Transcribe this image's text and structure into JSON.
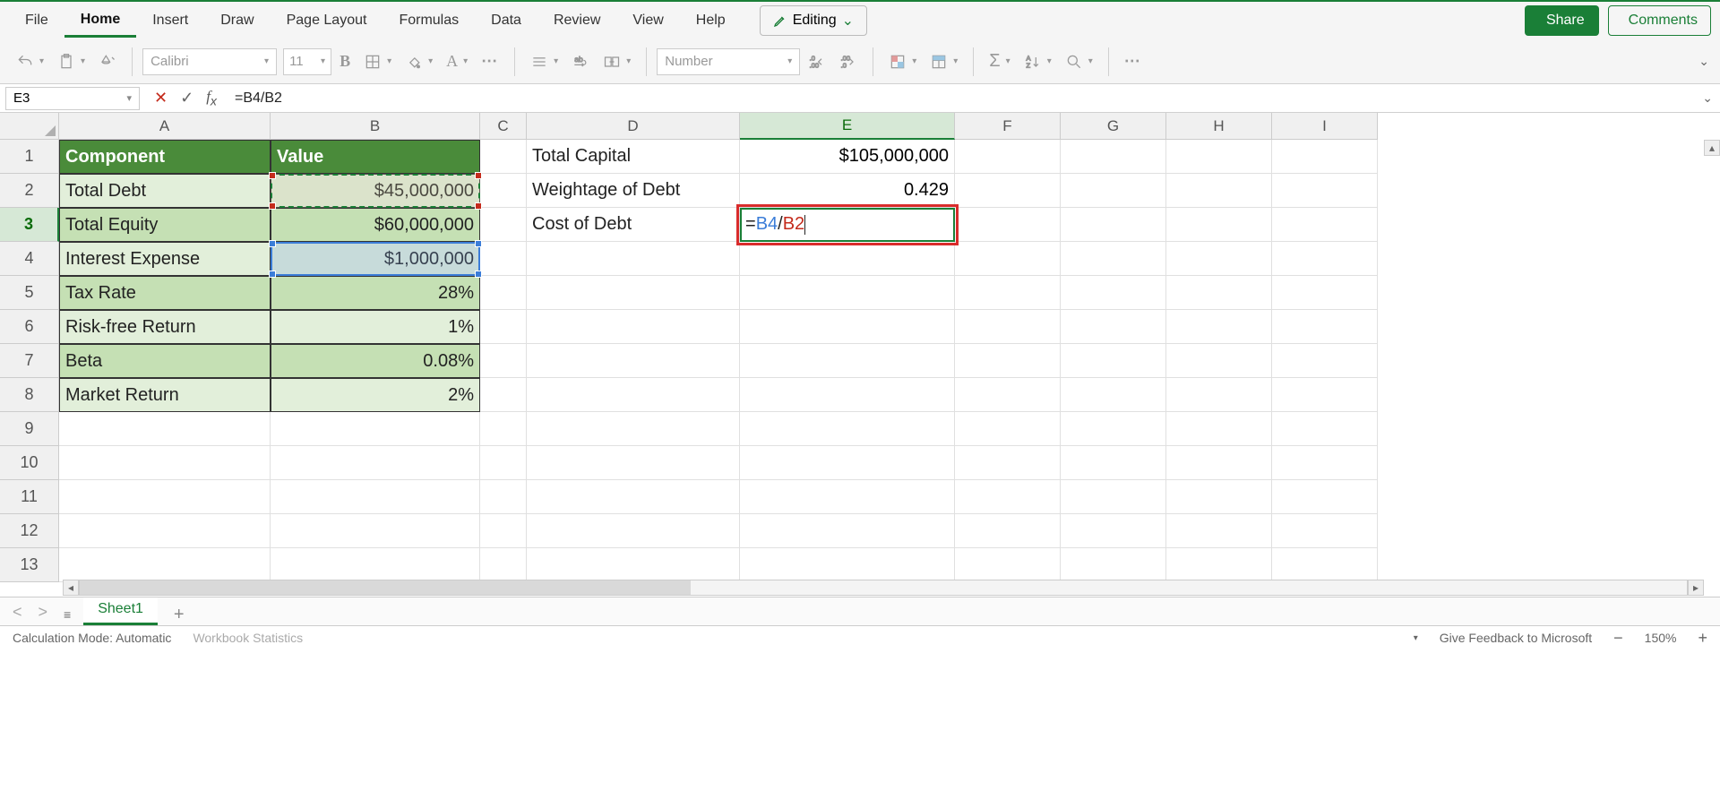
{
  "menu": {
    "items": [
      "File",
      "Home",
      "Insert",
      "Draw",
      "Page Layout",
      "Formulas",
      "Data",
      "Review",
      "View",
      "Help"
    ],
    "active": "Home",
    "mode": "Editing",
    "share": "Share",
    "comments": "Comments"
  },
  "ribbon": {
    "font_name": "Calibri",
    "font_size": "11",
    "number_format": "Number"
  },
  "formula_bar": {
    "name_box": "E3",
    "formula": "=B4/B2",
    "ref1": "B4",
    "ref2": "B2"
  },
  "columns": [
    "A",
    "B",
    "C",
    "D",
    "E",
    "F",
    "G",
    "H",
    "I"
  ],
  "active_col": "E",
  "rows": [
    1,
    2,
    3,
    4,
    5,
    6,
    7,
    8,
    9,
    10,
    11,
    12,
    13
  ],
  "active_row": 3,
  "table": {
    "header_a": "Component",
    "header_b": "Value",
    "rows": [
      {
        "a": "Total Debt",
        "b": "$45,000,000"
      },
      {
        "a": "Total Equity",
        "b": "$60,000,000"
      },
      {
        "a": "Interest Expense",
        "b": "$1,000,000"
      },
      {
        "a": "Tax Rate",
        "b": "28%"
      },
      {
        "a": "Risk-free Return",
        "b": "1%"
      },
      {
        "a": "Beta",
        "b": "0.08%"
      },
      {
        "a": "Market Return",
        "b": "2%"
      }
    ]
  },
  "side": {
    "d1": "Total Capital",
    "e1": "$105,000,000",
    "d2": "Weightage of Debt",
    "e2": "0.429",
    "d3": "Cost of Debt"
  },
  "sheet_tab": "Sheet1",
  "status": {
    "calc": "Calculation Mode: Automatic",
    "stats": "Workbook Statistics",
    "feedback": "Give Feedback to Microsoft",
    "zoom": "150%"
  }
}
